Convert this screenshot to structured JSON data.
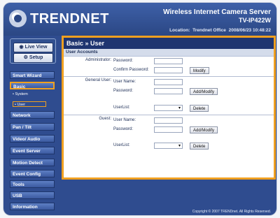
{
  "header": {
    "logo": "TRENDNET",
    "product_title": "Wireless Internet Camera Server",
    "model": "TV-IP422W",
    "location_label": "Location:",
    "location_value": "Trendnet Office",
    "timestamp": "2008/06/23 10:48:22"
  },
  "sidebar": {
    "live_view": "Live View",
    "setup": "Setup",
    "nav": [
      {
        "label": "Smart Wizard"
      },
      {
        "label": "Basic"
      },
      {
        "label": "Network"
      },
      {
        "label": "Pan / Tilt"
      },
      {
        "label": "Video/ Audio"
      },
      {
        "label": "Event Server"
      },
      {
        "label": "Motion Detect"
      },
      {
        "label": "Event Config"
      },
      {
        "label": "Tools"
      },
      {
        "label": "USB"
      },
      {
        "label": "Information"
      }
    ],
    "sub_items": [
      {
        "label": "• System"
      },
      {
        "label": "• User"
      }
    ]
  },
  "main": {
    "title": "Basic » User",
    "section_title": "User Accounts",
    "admin": {
      "label": "Administrator:",
      "password_label": "Password:",
      "confirm_label": "Confirm Password:",
      "modify_button": "Modify"
    },
    "general": {
      "label": "General User:",
      "username_label": "User Name:",
      "password_label": "Password:",
      "add_modify_button": "Add/Modify",
      "userlist_label": "UserList:",
      "delete_button": "Delete"
    },
    "guest": {
      "label": "Guest:",
      "username_label": "User Name:",
      "password_label": "Password:",
      "add_modify_button": "Add/Modify",
      "userlist_label": "UserList:",
      "delete_button": "Delete"
    }
  },
  "footer": "Copyright © 2007 TRENDnet. All Rights Reserved."
}
